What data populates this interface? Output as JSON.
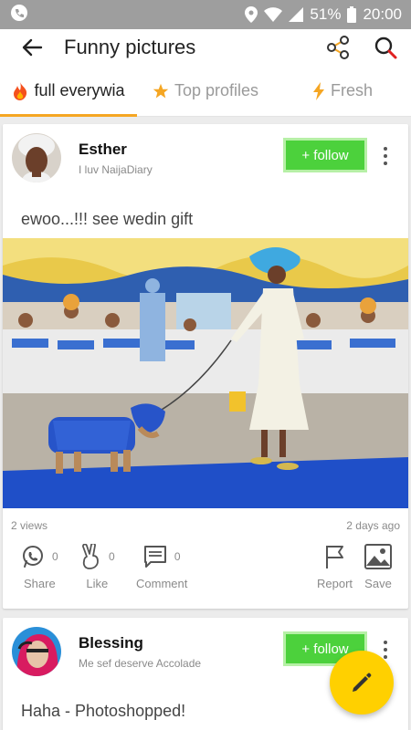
{
  "status_bar": {
    "battery": "51%",
    "time": "20:00"
  },
  "app_bar": {
    "title": "Funny pictures"
  },
  "tabs": [
    {
      "label": "full everywia",
      "icon": "fire-icon",
      "active": true
    },
    {
      "label": "Top profiles",
      "icon": "star-icon",
      "active": false
    },
    {
      "label": "Fresh",
      "icon": "lightning-icon",
      "active": false
    }
  ],
  "posts": [
    {
      "author": "Esther",
      "tagline": "I luv NaijaDiary",
      "follow_label": "+ follow",
      "caption": "ewoo...!!! see wedin gift",
      "views": "2 views",
      "time": "2 days ago",
      "actions": {
        "share_label": "Share",
        "share_count": "0",
        "like_label": "Like",
        "like_count": "0",
        "comment_label": "Comment",
        "comment_count": "0",
        "report_label": "Report",
        "save_label": "Save"
      }
    },
    {
      "author": "Blessing",
      "tagline": "Me sef deserve Accolade",
      "follow_label": "+ follow",
      "caption": "Haha - Photoshopped!"
    }
  ],
  "colors": {
    "accent": "#f5a623",
    "follow": "#4cd13c",
    "fab": "#ffd000"
  }
}
